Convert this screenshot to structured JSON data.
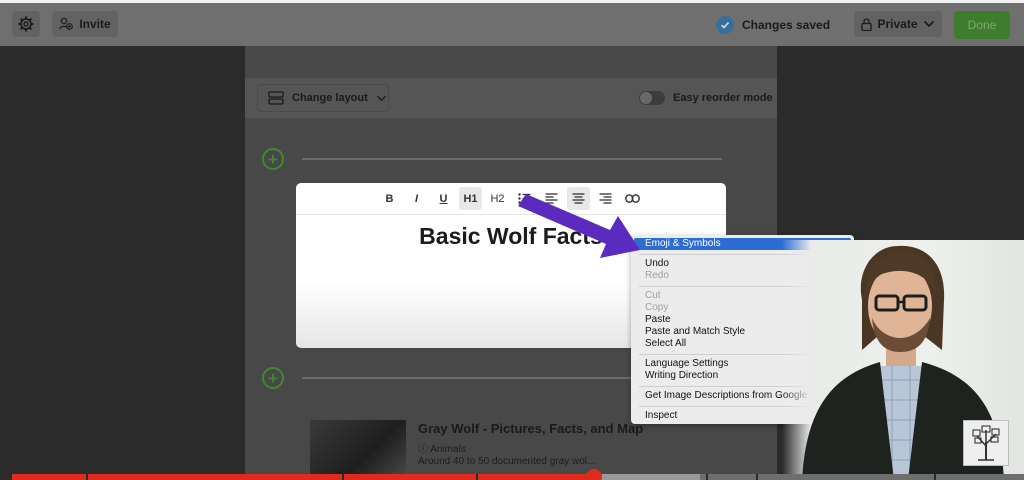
{
  "topbar": {
    "settings_icon": "gear-icon",
    "invite_label": "Invite",
    "invite_icon": "add-person-icon",
    "status_text": "Changes saved",
    "status_icon": "check-circle-icon",
    "privacy_label": "Private",
    "privacy_icon": "lock-icon",
    "done_label": "Done"
  },
  "layout_bar": {
    "change_layout_label": "Change layout",
    "reorder_label": "Easy reorder mode"
  },
  "editor": {
    "toolbar": [
      {
        "label": "B",
        "name": "bold-button"
      },
      {
        "label": "I",
        "name": "italic-button"
      },
      {
        "label": "U",
        "name": "underline-button"
      },
      {
        "label": "H1",
        "name": "heading1-button"
      },
      {
        "label": "H2",
        "name": "heading2-button"
      }
    ],
    "title": "Basic Wolf Facts"
  },
  "result": {
    "title": "Gray Wolf - Pictures, Facts, and Map",
    "meta": "ⓘ Animals",
    "desc": "Around 40 to 50 documented gray wol..."
  },
  "context_menu": {
    "groups": [
      [
        {
          "label": "Emoji & Symbols",
          "state": "highlighted"
        }
      ],
      [
        {
          "label": "Undo",
          "state": "enabled"
        },
        {
          "label": "Redo",
          "state": "disabled"
        }
      ],
      [
        {
          "label": "Cut",
          "state": "disabled"
        },
        {
          "label": "Copy",
          "state": "disabled"
        },
        {
          "label": "Paste",
          "state": "enabled"
        },
        {
          "label": "Paste and Match Style",
          "state": "enabled"
        },
        {
          "label": "Select All",
          "state": "enabled"
        }
      ],
      [
        {
          "label": "Language Settings",
          "state": "enabled"
        },
        {
          "label": "Writing Direction",
          "state": "enabled"
        }
      ],
      [
        {
          "label": "Get Image Descriptions from Google",
          "state": "enabled"
        }
      ],
      [
        {
          "label": "Inspect",
          "state": "enabled"
        }
      ]
    ]
  },
  "video": {
    "progress_percent": 57.5,
    "buffered_percent": 68,
    "accent_color": "#e02a1b"
  },
  "colors": {
    "done_green": "#3e7d2e",
    "add_green": "#3f8a2e",
    "highlight_blue": "#2d6dd3",
    "arrow_purple": "#5b2bbf"
  }
}
